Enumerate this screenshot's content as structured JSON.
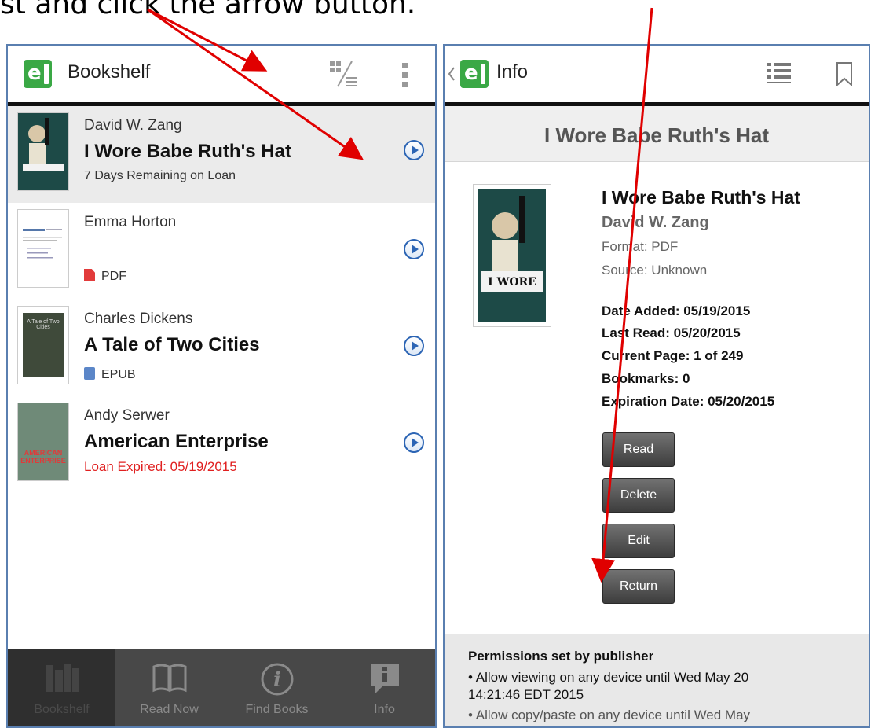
{
  "caption": "st and click the arrow button.",
  "bookshelf": {
    "title": "Bookshelf",
    "books": [
      {
        "author": "David W. Zang",
        "title": "I Wore Babe Ruth's Hat",
        "status": "7 Days Remaining on Loan",
        "format": "",
        "cover_text": "I WORE"
      },
      {
        "author": "Emma Horton",
        "title": "",
        "status": "",
        "format": "PDF"
      },
      {
        "author": "Charles Dickens",
        "title": "A Tale of Two Cities",
        "status": "",
        "format": "EPUB",
        "cover_text": "A Tale of Two Cities"
      },
      {
        "author": "Andy Serwer",
        "title": "American Enterprise",
        "status": "Loan Expired: 05/19/2015",
        "format": "",
        "cover_text": "AMERICAN ENTERPRISE"
      }
    ],
    "tabs": [
      {
        "label": "Bookshelf"
      },
      {
        "label": "Read Now"
      },
      {
        "label": "Find Books"
      },
      {
        "label": "Info"
      }
    ]
  },
  "info": {
    "title": "Info",
    "header": "I Wore Babe Ruth's Hat",
    "book_title": "I Wore Babe Ruth's Hat",
    "author": "David W. Zang",
    "format": "Format: PDF",
    "source": "Source: Unknown",
    "date_added": "Date Added: 05/19/2015",
    "last_read": "Last Read: 05/20/2015",
    "current_page": "Current Page: 1 of 249",
    "bookmarks": "Bookmarks: 0",
    "expiration": "Expiration Date: 05/20/2015",
    "buttons": {
      "read": "Read",
      "delete": "Delete",
      "edit": "Edit",
      "return": "Return"
    },
    "permissions": {
      "heading": "Permissions set by publisher",
      "line1": "• Allow viewing on any device until Wed May 20",
      "line2": "14:21:46 EDT 2015",
      "line3": "• Allow copy/paste on any device until Wed May"
    }
  },
  "colors": {
    "accent_green": "#3aa845",
    "annotation_red": "#e00000",
    "link_blue": "#2b64b4"
  }
}
